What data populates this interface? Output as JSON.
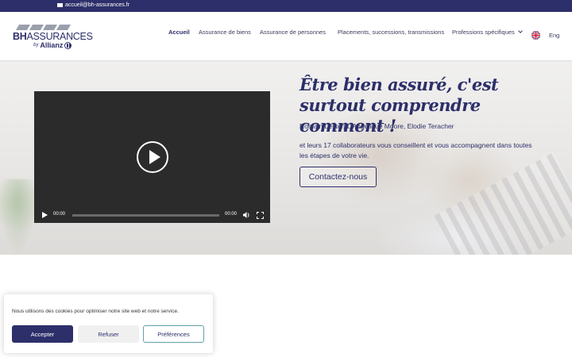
{
  "topbar": {
    "email": "accueil@bh-assurances.fr",
    "email_icon": "mail-icon"
  },
  "logo": {
    "bh": "BH",
    "assurances": "ASSURANCES",
    "by": "by",
    "allianz": "Allianz"
  },
  "nav": {
    "items": [
      {
        "label": "Accueil",
        "active": true
      },
      {
        "label": "Assurance de biens"
      },
      {
        "label": "Assurance de personnes"
      },
      {
        "label": "Placements, successions, transmissions"
      },
      {
        "label": "Professions spécifiques"
      }
    ],
    "language": "Eng"
  },
  "hero": {
    "headline": "Être bien assuré, c'est surtout comprendre comment !",
    "names": "Romain Lesterpt, Angélique Moore, Elodie Teracher",
    "description": "et leurs 17 collaborateurs vous conseillent et vous accompagnent dans toutes les étapes de votre vie.",
    "cta": "Contactez-nous"
  },
  "video": {
    "current_time": "00:00",
    "duration": "00:00"
  },
  "cookie": {
    "text": "Nous utilisons des cookies pour optimiser notre site web et notre service.",
    "accept": "Accepter",
    "refuse": "Refuser",
    "preferences": "Préférences"
  },
  "colors": {
    "brand": "#2d2f6a",
    "accent_border": "#64a0a8"
  }
}
